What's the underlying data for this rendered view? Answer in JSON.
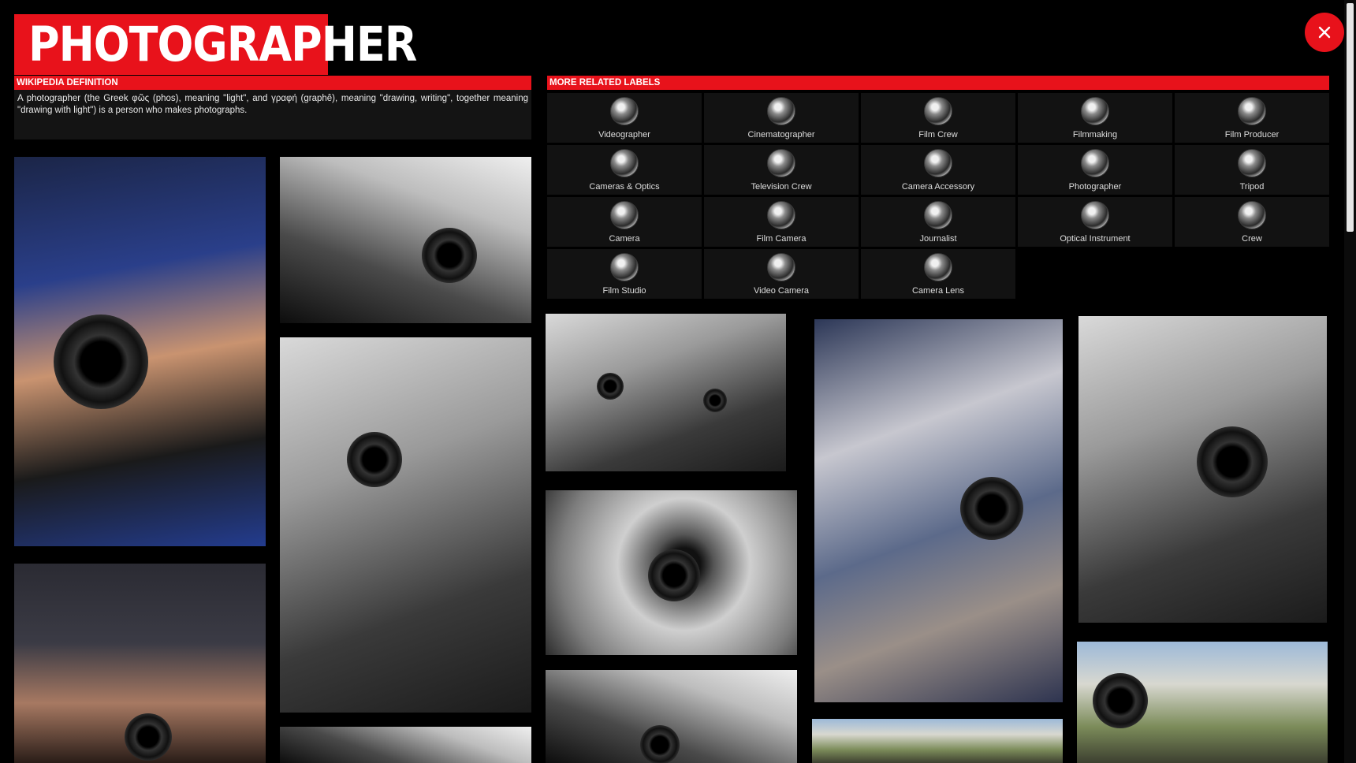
{
  "header": {
    "title": "PHOTOGRAPHER",
    "close_icon": "close-icon"
  },
  "colors": {
    "accent": "#e8121b",
    "background": "#000000",
    "tile": "#121212"
  },
  "wikipedia": {
    "heading": "WIKIPEDIA DEFINITION",
    "text": "A photographer (the Greek φῶς (phos), meaning \"light\", and γραφή (graphê), meaning \"drawing, writing\", together meaning \"drawing with light\") is a person who makes photographs."
  },
  "related": {
    "heading": "MORE RELATED LABELS",
    "items": [
      {
        "label": "Videographer"
      },
      {
        "label": "Cinematographer"
      },
      {
        "label": "Film Crew"
      },
      {
        "label": "Filmmaking"
      },
      {
        "label": "Film Producer"
      },
      {
        "label": "Cameras & Optics"
      },
      {
        "label": "Television Crew"
      },
      {
        "label": "Camera Accessory"
      },
      {
        "label": "Photographer"
      },
      {
        "label": "Tripod"
      },
      {
        "label": "Camera"
      },
      {
        "label": "Film Camera"
      },
      {
        "label": "Journalist"
      },
      {
        "label": "Optical Instrument"
      },
      {
        "label": "Crew"
      },
      {
        "label": "Film Studio"
      },
      {
        "label": "Video Camera"
      },
      {
        "label": "Camera Lens"
      }
    ]
  }
}
